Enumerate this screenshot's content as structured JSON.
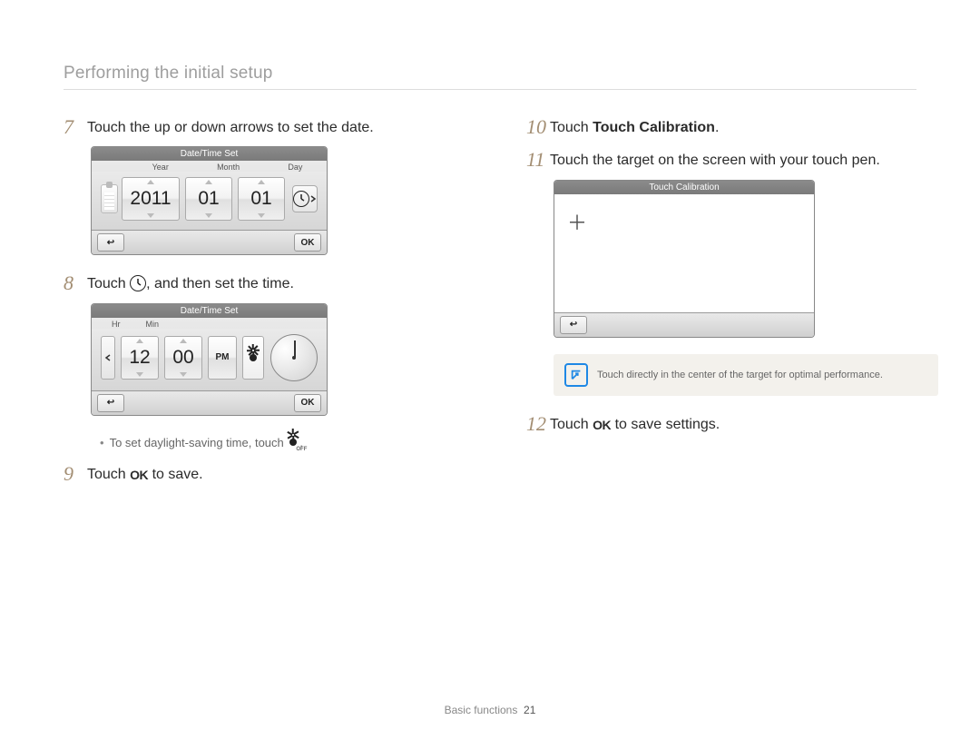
{
  "section_title": "Performing the initial setup",
  "steps": {
    "s7": {
      "num": "7",
      "text": "Touch the up or down arrows to set the date."
    },
    "s8": {
      "num": "8",
      "pre": "Touch ",
      "post": ", and then set the time."
    },
    "s8_bullet": {
      "pre": "To set daylight-saving time, touch ",
      "post": "."
    },
    "s9": {
      "num": "9",
      "pre": "Touch ",
      "post": " to save."
    },
    "s10": {
      "num": "10",
      "pre": "Touch ",
      "bold": "Touch Calibration",
      "post": "."
    },
    "s11": {
      "num": "11",
      "text": "Touch the target on the screen with your touch pen."
    },
    "s12": {
      "num": "12",
      "pre": "Touch ",
      "post": " to save settings."
    }
  },
  "date_screen": {
    "title": "Date/Time Set",
    "labels": {
      "year": "Year",
      "month": "Month",
      "day": "Day"
    },
    "values": {
      "year": "2011",
      "month": "01",
      "day": "01"
    },
    "ok": "OK",
    "back": "↩"
  },
  "time_screen": {
    "title": "Date/Time Set",
    "labels": {
      "hr": "Hr",
      "min": "Min"
    },
    "values": {
      "hr": "12",
      "min": "00",
      "ampm": "PM"
    },
    "ok": "OK",
    "back": "↩"
  },
  "cal_screen": {
    "title": "Touch Calibration",
    "target": "＋",
    "back": "↩"
  },
  "note": {
    "text": "Touch directly in the center of the target for optimal performance."
  },
  "inline": {
    "ok": "OK"
  },
  "footer": {
    "label": "Basic functions",
    "page": "21"
  }
}
